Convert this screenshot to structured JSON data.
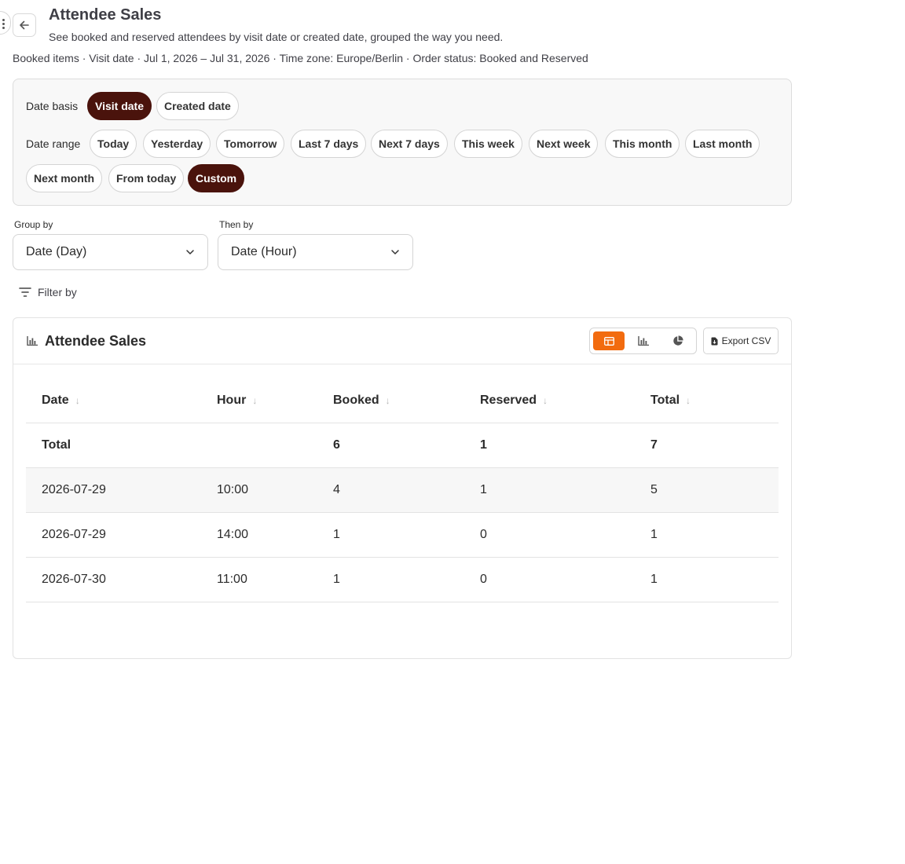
{
  "header": {
    "title": "Attendee Sales",
    "subtitle": "See booked and reserved attendees by visit date or created date, grouped the way you need.",
    "meta": "Booked items · Visit date · Jul 1, 2026 – Jul 31, 2026 · Time zone: Europe/Berlin · Order status: Booked and Reserved"
  },
  "date_basis": {
    "label": "Date basis",
    "options": [
      "Visit date",
      "Created date"
    ],
    "selected": "Visit date"
  },
  "date_range": {
    "label": "Date range",
    "options": [
      "Today",
      "Yesterday",
      "Tomorrow",
      "Last 7 days",
      "Next 7 days",
      "This week",
      "Next week",
      "This month",
      "Last month",
      "Next month",
      "From today",
      "Custom"
    ],
    "selected": "Custom"
  },
  "group_by": {
    "label": "Group by",
    "value": "Date (Day)"
  },
  "then_by": {
    "label": "Then by",
    "value": "Date (Hour)"
  },
  "filter_by": {
    "label": "Filter by"
  },
  "report": {
    "title": "Attendee Sales",
    "active_view": "table",
    "export_label": "Export CSV",
    "columns": [
      "Date",
      "Hour",
      "Booked",
      "Reserved",
      "Total"
    ],
    "total_row": {
      "label": "Total",
      "hour": "",
      "booked": "6",
      "reserved": "1",
      "total": "7"
    },
    "rows": [
      {
        "date": "2026-07-29",
        "hour": "10:00",
        "booked": "4",
        "reserved": "1",
        "total": "5"
      },
      {
        "date": "2026-07-29",
        "hour": "14:00",
        "booked": "1",
        "reserved": "0",
        "total": "1"
      },
      {
        "date": "2026-07-30",
        "hour": "11:00",
        "booked": "1",
        "reserved": "0",
        "total": "1"
      }
    ]
  },
  "colors": {
    "accent_dark": "#4a130c",
    "accent_orange": "#f26b0f"
  }
}
